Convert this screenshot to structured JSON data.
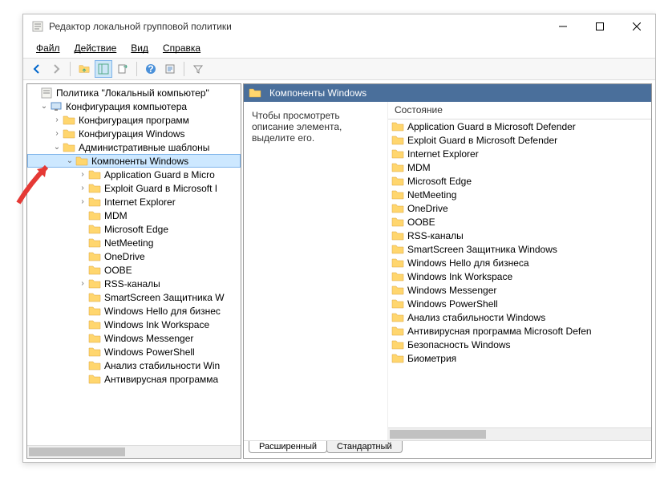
{
  "window": {
    "title": "Редактор локальной групповой политики",
    "min": "─",
    "max": "▢",
    "close": "✕"
  },
  "menu": {
    "file": "Файл",
    "action": "Действие",
    "view": "Вид",
    "help": "Справка"
  },
  "tree": {
    "root": "Политика \"Локальный компьютер\"",
    "comp_config": "Конфигурация компьютера",
    "soft": "Конфигурация программ",
    "win": "Конфигурация Windows",
    "admin": "Административные шаблоны",
    "components": "Компоненты Windows",
    "c1": "Application Guard в Micro",
    "c2": "Exploit Guard в Microsoft I",
    "c3": "Internet Explorer",
    "c4": "MDM",
    "c5": "Microsoft Edge",
    "c6": "NetMeeting",
    "c7": "OneDrive",
    "c8": "OOBE",
    "c9": "RSS-каналы",
    "c10": "SmartScreen Защитника W",
    "c11": "Windows Hello для бизнес",
    "c12": "Windows Ink Workspace",
    "c13": "Windows Messenger",
    "c14": "Windows PowerShell",
    "c15": "Анализ стабильности Win",
    "c16": "Антивирусная программа"
  },
  "right": {
    "header": "Компоненты Windows",
    "desc": "Чтобы просмотреть описание элемента, выделите его.",
    "state": "Состояние",
    "items": [
      "Application Guard в Microsoft Defender",
      "Exploit Guard в Microsoft Defender",
      "Internet Explorer",
      "MDM",
      "Microsoft Edge",
      "NetMeeting",
      "OneDrive",
      "OOBE",
      "RSS-каналы",
      "SmartScreen Защитника Windows",
      "Windows Hello для бизнеса",
      "Windows Ink Workspace",
      "Windows Messenger",
      "Windows PowerShell",
      "Анализ стабильности Windows",
      "Антивирусная программа Microsoft Defen",
      "Безопасность Windows",
      "Биометрия"
    ]
  },
  "tabs": {
    "ext": "Расширенный",
    "std": "Стандартный"
  }
}
